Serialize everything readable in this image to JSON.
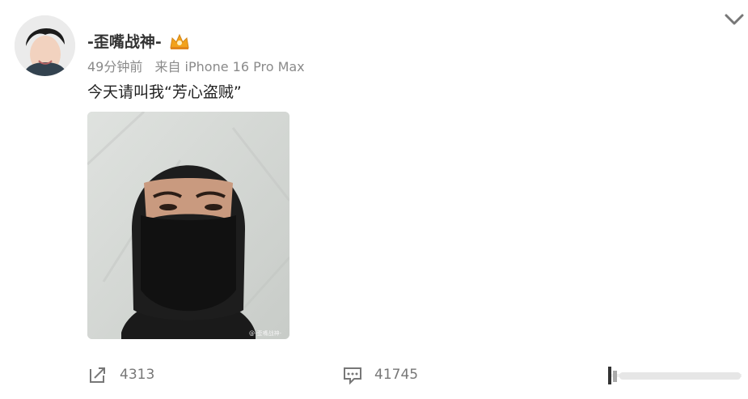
{
  "post": {
    "username": "-歪嘴战神-",
    "time_ago": "49分钟前",
    "source": "来自 iPhone 16 Pro Max",
    "text": "今天请叫我“芳心盗贼”",
    "image_watermark": "@-歪嘴战神-"
  },
  "actions": {
    "share_count": "4313",
    "comment_count": "41745"
  },
  "icons": {
    "avatar": "user-avatar",
    "badge": "crown-badge-icon",
    "share": "share-icon",
    "comment": "comment-icon",
    "menu": "chevron-down-icon"
  }
}
